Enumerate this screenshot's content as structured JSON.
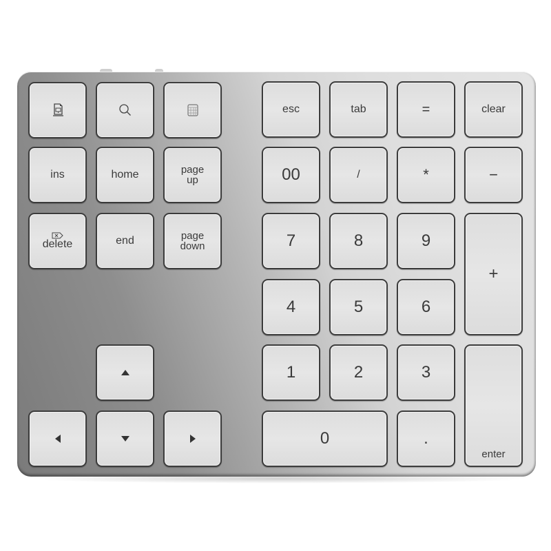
{
  "product": "Wireless numeric keypad (34 keys, silver aluminum)",
  "colors": {
    "body_light": "#e2e2e2",
    "body_dark": "#7a7a7a",
    "key_face": "#e2e2e2",
    "key_outline": "#3c3c3c",
    "legend": "#3a3a3a"
  },
  "left_block": {
    "row1": [
      {
        "icon": "calculator-document-icon",
        "label": ""
      },
      {
        "icon": "search-icon",
        "label": ""
      },
      {
        "icon": "calendar-icon",
        "label": ""
      }
    ],
    "row2": [
      {
        "label": "ins"
      },
      {
        "label": "home"
      },
      {
        "label": "page",
        "label2": "up"
      }
    ],
    "row3": [
      {
        "icon": "delete-icon",
        "label": "delete"
      },
      {
        "label": "end"
      },
      {
        "label": "page",
        "label2": "down"
      }
    ],
    "arrows": {
      "up": "arrow-up-icon",
      "left": "arrow-left-icon",
      "down": "arrow-down-icon",
      "right": "arrow-right-icon"
    }
  },
  "numpad": {
    "row1": [
      "esc",
      "tab",
      "=",
      "clear"
    ],
    "row2": [
      "00",
      "/",
      "*",
      "−"
    ],
    "row3": [
      "7",
      "8",
      "9"
    ],
    "row4": [
      "4",
      "5",
      "6"
    ],
    "row5": [
      "1",
      "2",
      "3"
    ],
    "row6": [
      "0",
      "."
    ],
    "plus": "+",
    "enter": "enter"
  }
}
